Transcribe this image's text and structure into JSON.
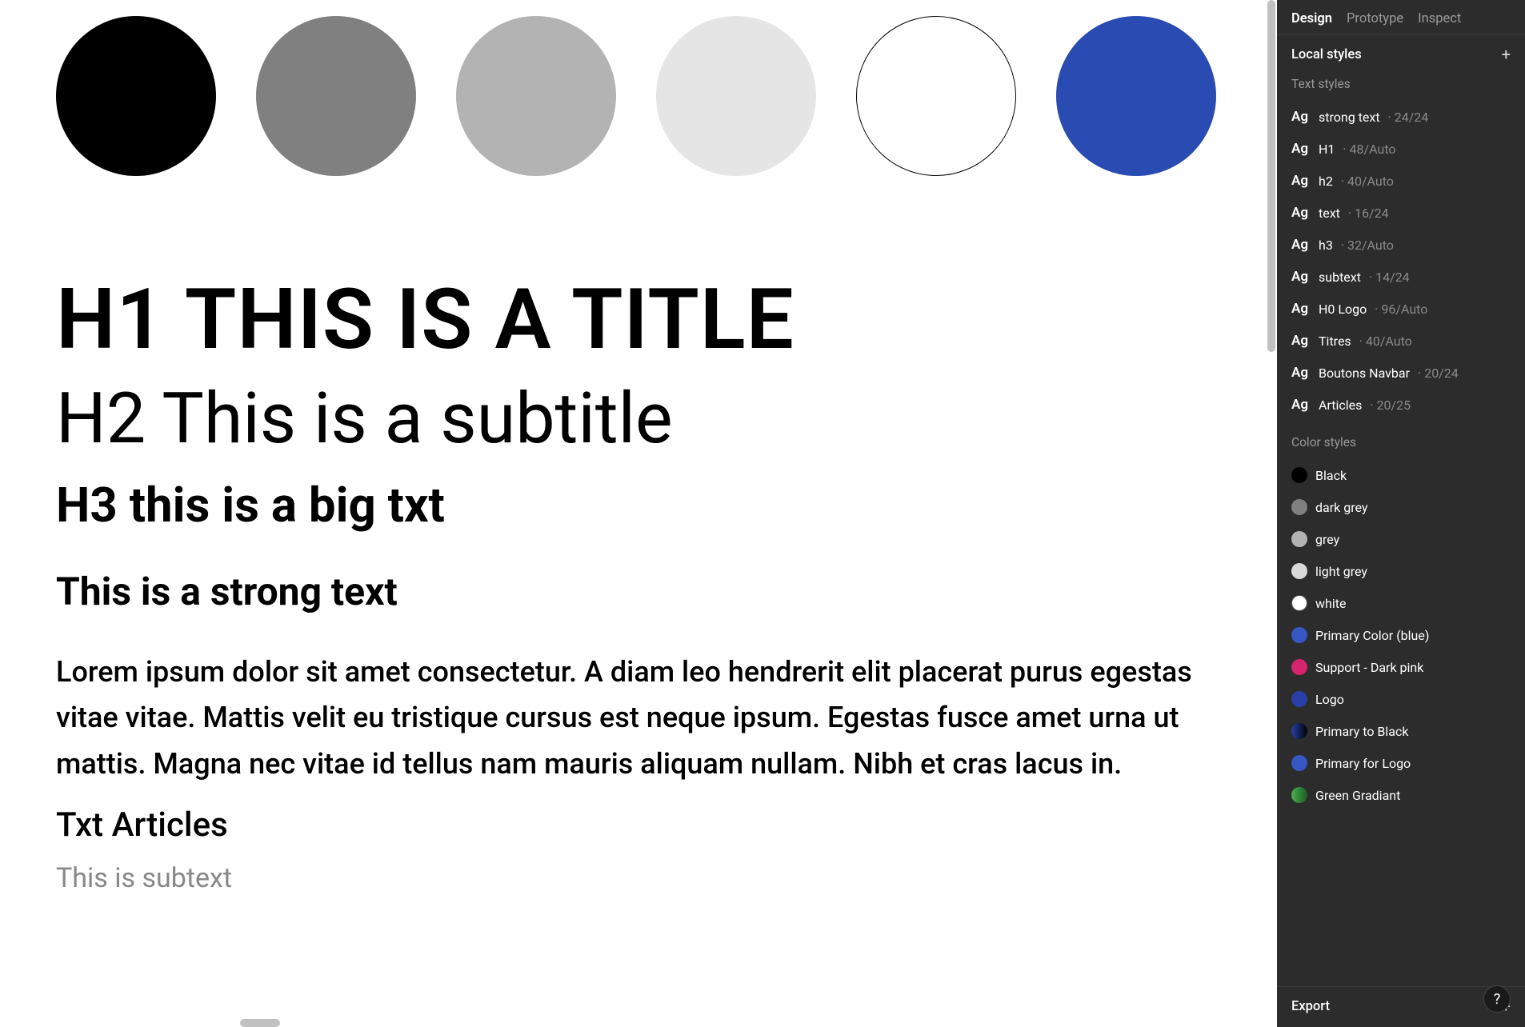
{
  "canvas": {
    "swatches": [
      {
        "hex": "#000000"
      },
      {
        "hex": "#808080"
      },
      {
        "hex": "#b3b3b3"
      },
      {
        "hex": "#e5e5e5"
      },
      {
        "hex": "#ffffff",
        "bordered": true
      },
      {
        "hex": "#294bb2"
      }
    ],
    "h1": "H1 THIS IS A TITLE",
    "h2": "H2 This is a subtitle",
    "h3": "H3 this is a big txt",
    "strong": "This is a strong text",
    "body": "Lorem ipsum dolor sit amet consectetur. A diam leo hendrerit elit placerat purus egestas vitae vitae. Mattis velit eu tristique cursus est neque ipsum. Egestas fusce amet urna ut mattis. Magna nec vitae id tellus nam mauris aliquam nullam. Nibh et cras lacus in.",
    "articles": "Txt Articles",
    "subtext": "This is subtext"
  },
  "panel": {
    "tabs": {
      "design": "Design",
      "prototype": "Prototype",
      "inspect": "Inspect"
    },
    "local_styles_title": "Local styles",
    "text_styles_heading": "Text styles",
    "text_styles": [
      {
        "name": "strong text",
        "meta": "24/24"
      },
      {
        "name": "H1",
        "meta": "48/Auto"
      },
      {
        "name": "h2",
        "meta": "40/Auto"
      },
      {
        "name": "text",
        "meta": "16/24"
      },
      {
        "name": "h3",
        "meta": "32/Auto"
      },
      {
        "name": "subtext",
        "meta": "14/24"
      },
      {
        "name": "H0 Logo",
        "meta": "96/Auto"
      },
      {
        "name": "Titres",
        "meta": "40/Auto"
      },
      {
        "name": "Boutons Navbar",
        "meta": "20/24"
      },
      {
        "name": "Articles",
        "meta": "20/25"
      }
    ],
    "color_styles_heading": "Color styles",
    "color_styles": [
      {
        "name": "Black",
        "hex": "#000000"
      },
      {
        "name": "dark grey",
        "hex": "#808080"
      },
      {
        "name": "grey",
        "hex": "#b3b3b3"
      },
      {
        "name": "light grey",
        "hex": "#d9d9d9"
      },
      {
        "name": "white",
        "hex": "#ffffff",
        "white": true
      },
      {
        "name": "Primary Color (blue)",
        "hex": "#3558c4"
      },
      {
        "name": "Support - Dark pink",
        "hex": "#d6246e"
      },
      {
        "name": "Logo",
        "hex": "#2a3fa8"
      },
      {
        "name": "Primary to Black",
        "hex": "#2a3fa8",
        "gradient": "linear-gradient(90deg,#2a3fa8,#000)"
      },
      {
        "name": "Primary for Logo",
        "hex": "#3558c4"
      },
      {
        "name": "Green Gradiant",
        "hex": "#4caf50",
        "gradient": "linear-gradient(90deg,#4caf50,#1b5e20)"
      }
    ],
    "export_title": "Export",
    "help_label": "?"
  }
}
